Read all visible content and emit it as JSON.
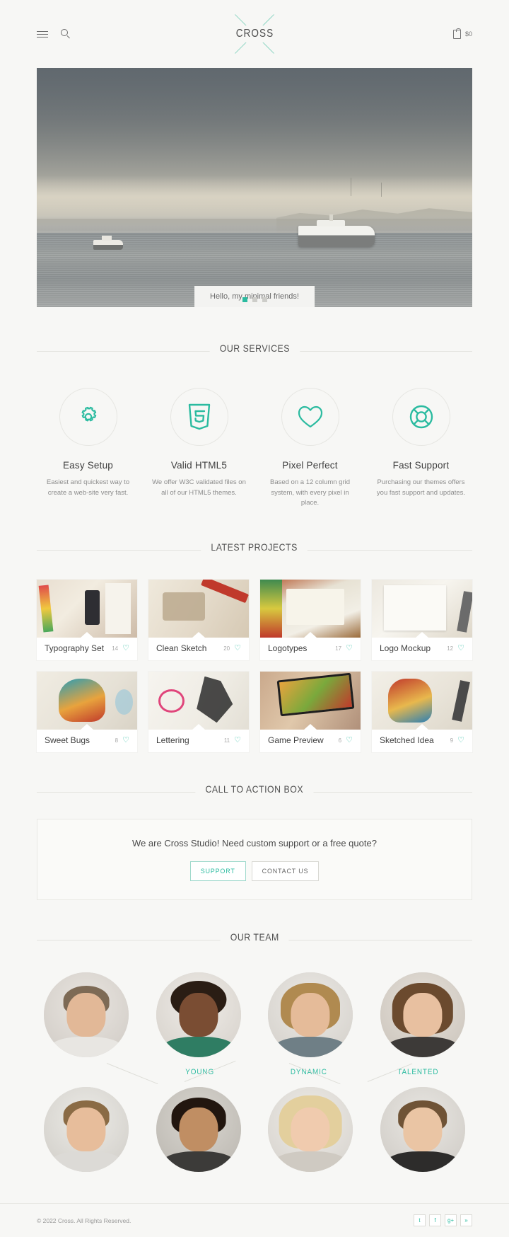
{
  "header": {
    "menu_icon": "hamburger-icon",
    "search_icon": "search-icon",
    "brand": "CROSS",
    "cart_icon": "bag-icon",
    "cart_total": "$0"
  },
  "hero": {
    "caption": "Hello, my minimal friends!",
    "dots": [
      "active",
      "inactive",
      "inactive"
    ],
    "accent": "#2bbba0"
  },
  "services": {
    "title": "OUR SERVICES",
    "items": [
      {
        "icon": "gear-icon",
        "title": "Easy Setup",
        "desc": "Easiest and quickest way to create a web-site very fast."
      },
      {
        "icon": "html5-icon",
        "title": "Valid HTML5",
        "desc": "We offer W3C validated files on all of our HTML5 themes."
      },
      {
        "icon": "heart-icon",
        "title": "Pixel Perfect",
        "desc": "Based on a 12 column grid system, with every pixel in place."
      },
      {
        "icon": "lifebuoy-icon",
        "title": "Fast Support",
        "desc": "Purchasing our themes offers you fast support and updates."
      }
    ]
  },
  "projects": {
    "title": "LATEST PROJECTS",
    "items": [
      {
        "title": "Typography Set",
        "likes": "14"
      },
      {
        "title": "Clean Sketch",
        "likes": "20"
      },
      {
        "title": "Logotypes",
        "likes": "17"
      },
      {
        "title": "Logo Mockup",
        "likes": "12"
      },
      {
        "title": "Sweet Bugs",
        "likes": "8"
      },
      {
        "title": "Lettering",
        "likes": "11"
      },
      {
        "title": "Game Preview",
        "likes": "6"
      },
      {
        "title": "Sketched Idea",
        "likes": "9"
      }
    ]
  },
  "cta": {
    "title": "CALL TO ACTION BOX",
    "text": "We are Cross Studio! Need custom support or a free quote?",
    "support_label": "SUPPORT",
    "contact_label": "CONTACT US"
  },
  "team": {
    "title": "OUR TEAM",
    "labels": [
      "YOUNG",
      "DYNAMIC",
      "TALENTED"
    ],
    "members_row1": [
      "member-1",
      "member-2",
      "member-3",
      "member-4"
    ],
    "members_row2": [
      "member-5",
      "member-6",
      "member-7",
      "member-8"
    ]
  },
  "footer": {
    "copyright": "© 2022 Cross. All Rights Reserved.",
    "socials": [
      "twitter-icon",
      "facebook-icon",
      "google-plus-icon",
      "rss-icon"
    ],
    "social_glyphs": [
      "t",
      "f",
      "g+",
      "»"
    ]
  }
}
